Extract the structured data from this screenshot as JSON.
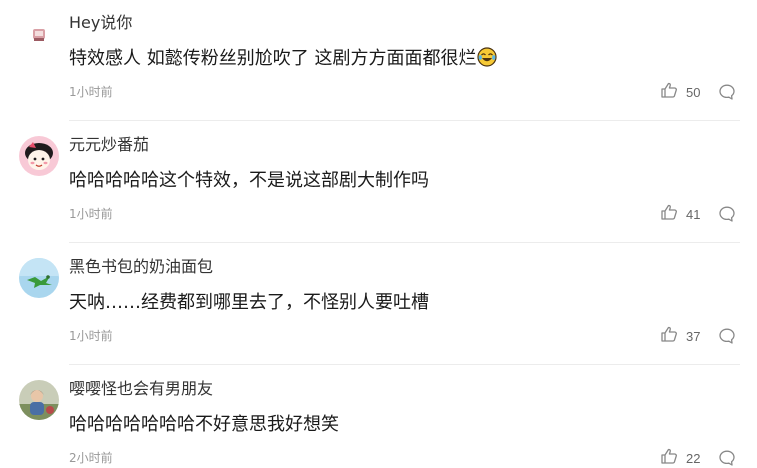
{
  "comments": [
    {
      "username": "Hey说你",
      "content": "特效感人 如懿传粉丝别尬吹了 这剧方方面面都很烂",
      "emoji_icon": "crying-laughing-emoji",
      "time": "1小时前",
      "likes": "50"
    },
    {
      "username": "元元炒番茄",
      "content": "哈哈哈哈哈这个特效，不是说这部剧大制作吗",
      "time": "1小时前",
      "likes": "41"
    },
    {
      "username": "黑色书包的奶油面包",
      "content": "天呐……经费都到哪里去了，不怪别人要吐槽",
      "time": "1小时前",
      "likes": "37"
    },
    {
      "username": "嘤嘤怪也会有男朋友",
      "content": "哈哈哈哈哈哈哈不好意思我好想笑",
      "time": "2小时前",
      "likes": "22"
    }
  ],
  "icons": {
    "like": "thumbs-up-icon",
    "reply": "comment-bubble-icon"
  },
  "colors": {
    "username": "#333333",
    "content": "#1a1a1a",
    "meta": "#999999",
    "divider": "#ececec"
  }
}
